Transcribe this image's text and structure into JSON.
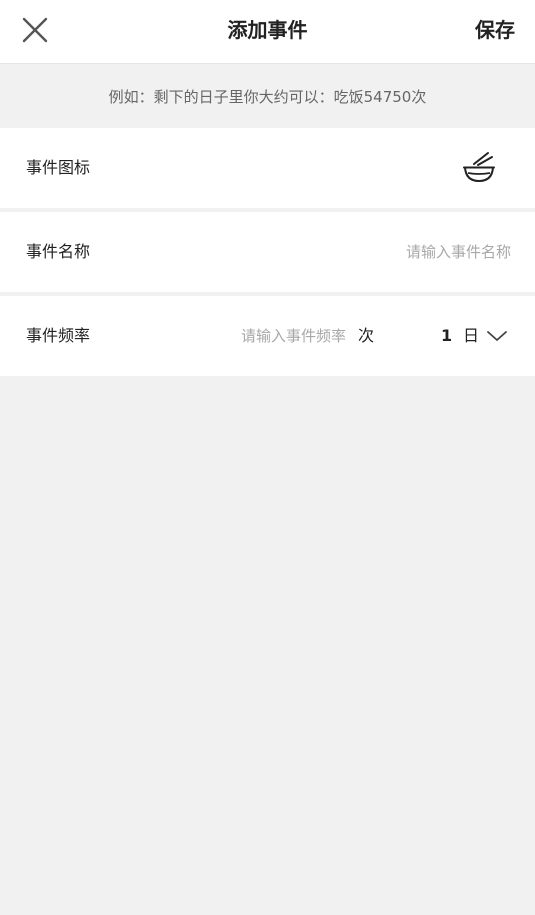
{
  "header": {
    "close_icon": "close-icon",
    "title": "添加事件",
    "save_label": "保存"
  },
  "hint": {
    "text": "例如：剩下的日子里你大约可以：吃饭54750次"
  },
  "form": {
    "icon_row": {
      "label": "事件图标",
      "icon": "bowl-chopsticks-icon"
    },
    "name_row": {
      "label": "事件名称",
      "placeholder": "请输入事件名称",
      "value": ""
    },
    "frequency_row": {
      "label": "事件频率",
      "placeholder": "请输入事件频率",
      "value": "",
      "unit": "次",
      "period_count": "1",
      "period_unit": "日",
      "dropdown_icon": "chevron-down-icon"
    }
  },
  "colors": {
    "background": "#f1f1f1",
    "surface": "#ffffff",
    "text": "#222222",
    "hint_text": "#666666",
    "placeholder": "#a8a8a8"
  }
}
